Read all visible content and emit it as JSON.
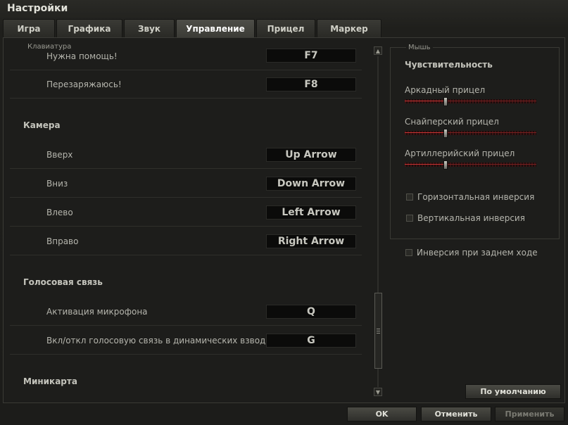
{
  "window": {
    "title": "Настройки"
  },
  "tabs": [
    {
      "label": "Игра"
    },
    {
      "label": "Графика"
    },
    {
      "label": "Звук"
    },
    {
      "label": "Управление"
    },
    {
      "label": "Прицел"
    },
    {
      "label": "Маркер"
    }
  ],
  "active_tab": "Управление",
  "keyboard": {
    "group_label": "Клавиатура",
    "rows_top": [
      {
        "label": "Нужна помощь!",
        "key": "F7"
      },
      {
        "label": "Перезаряжаюсь!",
        "key": "F8"
      }
    ],
    "camera": {
      "title": "Камера",
      "rows": [
        {
          "label": "Вверх",
          "key": "Up Arrow"
        },
        {
          "label": "Вниз",
          "key": "Down Arrow"
        },
        {
          "label": "Влево",
          "key": "Left Arrow"
        },
        {
          "label": "Вправо",
          "key": "Right Arrow"
        }
      ]
    },
    "voice": {
      "title": "Голосовая связь",
      "rows": [
        {
          "label": "Активация микрофона",
          "key": "Q"
        },
        {
          "label": "Вкл/откл голосовую связь в динамических взводах",
          "key": "G"
        }
      ]
    },
    "minimap": {
      "title": "Миникарта"
    }
  },
  "mouse": {
    "group_label": "Мышь",
    "sensitivity_title": "Чувствительность",
    "sliders": [
      {
        "label": "Аркадный прицел",
        "value": 0.31
      },
      {
        "label": "Снайперский прицел",
        "value": 0.31
      },
      {
        "label": "Артиллерийский прицел",
        "value": 0.31
      }
    ],
    "horizontal_inversion": {
      "label": "Горизонтальная инверсия",
      "checked": false
    },
    "vertical_inversion": {
      "label": "Вертикальная инверсия",
      "checked": false
    }
  },
  "reverse_inversion": {
    "label": "Инверсия при заднем ходе",
    "checked": false
  },
  "buttons": {
    "default": "По умолчанию",
    "ok": "OK",
    "cancel": "Отменить",
    "apply": "Применить"
  },
  "colors": {
    "background": "#1d1d1b",
    "slider_accent": "#c33333",
    "active_tab": "#4e4e48"
  }
}
